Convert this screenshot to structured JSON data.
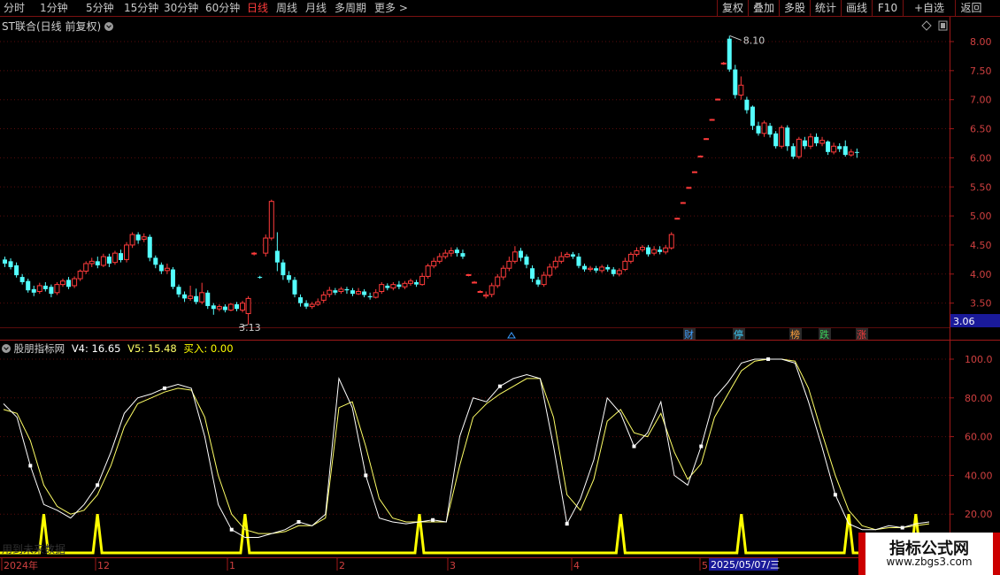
{
  "toolbar": {
    "periods": [
      "分时",
      "1分钟",
      "5分钟",
      "15分钟",
      "30分钟",
      "60分钟",
      "日线",
      "周线",
      "月线",
      "多周期",
      "更多 >"
    ],
    "active_period": "日线",
    "right_buttons": [
      "复权",
      "叠加",
      "多股",
      "统计",
      "画线",
      "F10",
      "+自选",
      "返回"
    ]
  },
  "main_chart": {
    "title": "ST联合(日线 前复权)",
    "price_axis_labels": [
      "8.00",
      "7.50",
      "7.00",
      "6.50",
      "6.00",
      "5.50",
      "5.00",
      "4.50",
      "4.00",
      "3.50"
    ],
    "high_label": "8.10",
    "low_label": "3.13",
    "current_price_tag": "3.06",
    "event_markers": [
      {
        "text": "财",
        "color": "#3c9dff"
      },
      {
        "text": "停",
        "color": "#3ccfff"
      },
      {
        "text": "榜",
        "color": "#ff9f3c"
      },
      {
        "text": "跌",
        "color": "#3ccf5a"
      },
      {
        "text": "涨",
        "color": "#ff3b3b"
      }
    ]
  },
  "indicator": {
    "name": "股朋指标网",
    "v4_label": "V4: 16.65",
    "v5_label": "V5: 15.48",
    "buy_label": "买入: 0.00",
    "axis_labels": [
      "100.0",
      "80.00",
      "60.00",
      "40.00",
      "20.00"
    ],
    "watermark_text": "用到未来数据"
  },
  "time_axis": {
    "labels": [
      "2024年",
      "12",
      "1",
      "2",
      "3",
      "4",
      "5"
    ],
    "cursor_date": "2025/05/07/三"
  },
  "watermark": {
    "title": "指标公式网",
    "url": "www.zbgs3.com"
  },
  "colors": {
    "up": "#ff3b3b",
    "down": "#54ffff",
    "v4_line": "#ffffff",
    "v5_line": "#ffff66",
    "buy_signal": "#ffff00",
    "border": "#7a1010"
  },
  "chart_data": [
    {
      "type": "candlestick",
      "title": "ST联合(日线 前复权)",
      "ylim": [
        3.06,
        8.25
      ],
      "candles": [
        [
          4.25,
          4.18,
          4.3,
          4.12
        ],
        [
          4.22,
          4.12,
          4.27,
          4.08
        ],
        [
          4.15,
          3.98,
          4.2,
          3.94
        ],
        [
          3.95,
          3.86,
          4.0,
          3.82
        ],
        [
          3.88,
          3.72,
          3.92,
          3.68
        ],
        [
          3.74,
          3.68,
          3.8,
          3.62
        ],
        [
          3.7,
          3.8,
          3.85,
          3.66
        ],
        [
          3.8,
          3.74,
          3.86,
          3.7
        ],
        [
          3.78,
          3.66,
          3.82,
          3.6
        ],
        [
          3.68,
          3.82,
          3.86,
          3.64
        ],
        [
          3.82,
          3.88,
          3.92,
          3.78
        ],
        [
          3.9,
          3.78,
          3.95,
          3.74
        ],
        [
          3.8,
          3.92,
          3.96,
          3.76
        ],
        [
          3.92,
          4.05,
          4.08,
          3.88
        ],
        [
          4.05,
          4.18,
          4.22,
          4.0
        ],
        [
          4.18,
          4.22,
          4.28,
          4.12
        ],
        [
          4.22,
          4.15,
          4.3,
          4.1
        ],
        [
          4.15,
          4.3,
          4.35,
          4.12
        ],
        [
          4.3,
          4.18,
          4.35,
          4.12
        ],
        [
          4.2,
          4.36,
          4.4,
          4.16
        ],
        [
          4.36,
          4.24,
          4.42,
          4.2
        ],
        [
          4.25,
          4.5,
          4.55,
          4.2
        ],
        [
          4.5,
          4.68,
          4.72,
          4.45
        ],
        [
          4.68,
          4.58,
          4.72,
          4.52
        ],
        [
          4.6,
          4.64,
          4.7,
          4.55
        ],
        [
          4.64,
          4.28,
          4.68,
          4.22
        ],
        [
          4.28,
          4.16,
          4.32,
          4.1
        ],
        [
          4.16,
          4.05,
          4.2,
          4.0
        ],
        [
          4.06,
          4.1,
          4.18,
          4.0
        ],
        [
          4.08,
          3.78,
          4.12,
          3.74
        ],
        [
          3.78,
          3.65,
          3.82,
          3.6
        ],
        [
          3.65,
          3.58,
          3.7,
          3.52
        ],
        [
          3.58,
          3.62,
          3.8,
          3.54
        ],
        [
          3.62,
          3.52,
          3.75,
          3.48
        ],
        [
          3.52,
          3.68,
          3.85,
          3.48
        ],
        [
          3.68,
          3.45,
          3.72,
          3.4
        ],
        [
          3.46,
          3.4,
          3.5,
          3.3
        ],
        [
          3.4,
          3.44,
          3.48,
          3.36
        ],
        [
          3.44,
          3.38,
          3.48,
          3.34
        ],
        [
          3.38,
          3.48,
          3.5,
          3.36
        ],
        [
          3.48,
          3.4,
          3.52,
          3.36
        ],
        [
          3.38,
          3.5,
          3.54,
          3.34
        ],
        [
          3.32,
          3.58,
          3.62,
          3.13
        ],
        [
          4.35,
          4.36,
          4.38,
          4.32
        ],
        [
          3.95,
          3.94,
          3.97,
          3.92
        ],
        [
          4.36,
          4.62,
          4.68,
          4.3
        ],
        [
          4.62,
          5.25,
          5.28,
          4.58
        ],
        [
          4.4,
          4.2,
          4.72,
          4.05
        ],
        [
          4.2,
          3.98,
          4.25,
          3.9
        ],
        [
          3.98,
          3.9,
          4.05,
          3.85
        ],
        [
          3.9,
          3.65,
          3.95,
          3.6
        ],
        [
          3.6,
          3.5,
          3.65,
          3.44
        ],
        [
          3.5,
          3.44,
          3.55,
          3.4
        ],
        [
          3.44,
          3.48,
          3.52,
          3.4
        ],
        [
          3.48,
          3.52,
          3.58,
          3.45
        ],
        [
          3.55,
          3.64,
          3.7,
          3.5
        ],
        [
          3.65,
          3.72,
          3.78,
          3.6
        ],
        [
          3.72,
          3.68,
          3.76,
          3.64
        ],
        [
          3.7,
          3.74,
          3.78,
          3.66
        ],
        [
          3.74,
          3.72,
          3.78,
          3.66
        ],
        [
          3.72,
          3.66,
          3.76,
          3.62
        ],
        [
          3.66,
          3.7,
          3.76,
          3.64
        ],
        [
          3.7,
          3.64,
          3.74,
          3.6
        ],
        [
          3.62,
          3.6,
          3.68,
          3.56
        ],
        [
          3.6,
          3.68,
          3.74,
          3.58
        ],
        [
          3.7,
          3.82,
          3.86,
          3.66
        ],
        [
          3.8,
          3.76,
          3.84,
          3.72
        ],
        [
          3.76,
          3.82,
          3.86,
          3.72
        ],
        [
          3.82,
          3.78,
          3.88,
          3.74
        ],
        [
          3.78,
          3.84,
          3.88,
          3.74
        ],
        [
          3.84,
          3.88,
          3.92,
          3.8
        ],
        [
          3.86,
          3.82,
          3.9,
          3.78
        ],
        [
          3.82,
          3.96,
          4.02,
          3.8
        ],
        [
          3.96,
          4.14,
          4.18,
          3.92
        ],
        [
          4.14,
          4.22,
          4.28,
          4.1
        ],
        [
          4.22,
          4.3,
          4.36,
          4.18
        ],
        [
          4.3,
          4.36,
          4.42,
          4.26
        ],
        [
          4.36,
          4.4,
          4.46,
          4.3
        ],
        [
          4.42,
          4.36,
          4.46,
          4.3
        ],
        [
          4.36,
          4.3,
          4.42,
          4.26
        ],
        [
          3.98,
          3.99,
          4.0,
          3.96
        ],
        [
          3.85,
          3.86,
          3.88,
          3.84
        ],
        [
          3.7,
          3.7,
          3.72,
          3.68
        ],
        [
          3.62,
          3.64,
          3.7,
          3.58
        ],
        [
          3.65,
          3.8,
          3.85,
          3.6
        ],
        [
          3.8,
          3.95,
          4.0,
          3.76
        ],
        [
          3.95,
          4.1,
          4.15,
          3.9
        ],
        [
          4.1,
          4.22,
          4.3,
          4.05
        ],
        [
          4.22,
          4.38,
          4.48,
          4.18
        ],
        [
          4.4,
          4.28,
          4.45,
          4.22
        ],
        [
          4.3,
          4.16,
          4.34,
          4.1
        ],
        [
          4.1,
          3.92,
          4.15,
          3.86
        ],
        [
          3.9,
          3.82,
          3.95,
          3.78
        ],
        [
          3.82,
          3.98,
          4.04,
          3.78
        ],
        [
          3.98,
          4.12,
          4.18,
          3.94
        ],
        [
          4.12,
          4.22,
          4.3,
          4.08
        ],
        [
          4.22,
          4.3,
          4.38,
          4.18
        ],
        [
          4.3,
          4.34,
          4.38,
          4.28
        ],
        [
          4.34,
          4.3,
          4.38,
          4.26
        ],
        [
          4.3,
          4.14,
          4.36,
          4.1
        ],
        [
          4.14,
          4.08,
          4.18,
          4.04
        ],
        [
          4.08,
          4.1,
          4.14,
          4.04
        ],
        [
          4.1,
          4.06,
          4.14,
          4.02
        ],
        [
          4.06,
          4.12,
          4.16,
          4.02
        ],
        [
          4.12,
          4.08,
          4.16,
          4.04
        ],
        [
          4.08,
          4.0,
          4.12,
          3.96
        ],
        [
          4.0,
          4.06,
          4.1,
          3.96
        ],
        [
          4.08,
          4.22,
          4.28,
          4.05
        ],
        [
          4.22,
          4.34,
          4.38,
          4.18
        ],
        [
          4.34,
          4.4,
          4.46,
          4.3
        ],
        [
          4.42,
          4.46,
          4.5,
          4.38
        ],
        [
          4.46,
          4.34,
          4.5,
          4.3
        ],
        [
          4.36,
          4.42,
          4.48,
          4.32
        ],
        [
          4.42,
          4.38,
          4.48,
          4.34
        ],
        [
          4.38,
          4.45,
          4.5,
          4.34
        ],
        [
          4.45,
          4.68,
          4.72,
          4.42
        ],
        [
          4.95,
          4.96,
          4.97,
          4.94
        ],
        [
          5.22,
          5.23,
          5.24,
          5.21
        ],
        [
          5.48,
          5.49,
          5.5,
          5.47
        ],
        [
          5.75,
          5.76,
          5.77,
          5.74
        ],
        [
          6.02,
          6.03,
          6.04,
          6.01
        ],
        [
          6.32,
          6.33,
          6.34,
          6.31
        ],
        [
          6.65,
          6.66,
          6.67,
          6.64
        ],
        [
          7.0,
          7.01,
          7.02,
          6.99
        ],
        [
          7.62,
          7.63,
          7.65,
          7.6
        ],
        [
          8.05,
          7.52,
          8.1,
          7.48
        ],
        [
          7.52,
          7.08,
          7.6,
          7.02
        ],
        [
          7.08,
          7.25,
          7.4,
          7.0
        ],
        [
          7.0,
          6.82,
          7.05,
          6.76
        ],
        [
          6.88,
          6.55,
          6.9,
          6.48
        ],
        [
          6.55,
          6.42,
          6.62,
          6.38
        ],
        [
          6.42,
          6.6,
          6.64,
          6.36
        ],
        [
          6.55,
          6.4,
          6.6,
          6.35
        ],
        [
          6.42,
          6.2,
          6.46,
          6.16
        ],
        [
          6.2,
          6.52,
          6.56,
          6.16
        ],
        [
          6.52,
          6.2,
          6.56,
          6.12
        ],
        [
          6.2,
          6.02,
          6.25,
          5.98
        ],
        [
          6.02,
          6.32,
          6.36,
          5.98
        ],
        [
          6.3,
          6.2,
          6.36,
          6.15
        ],
        [
          6.2,
          6.36,
          6.42,
          6.15
        ],
        [
          6.36,
          6.25,
          6.42,
          6.2
        ],
        [
          6.25,
          6.3,
          6.36,
          6.2
        ],
        [
          6.28,
          6.1,
          6.3,
          6.05
        ],
        [
          6.1,
          6.2,
          6.26,
          6.06
        ],
        [
          6.2,
          6.15,
          6.25,
          6.1
        ],
        [
          6.2,
          6.05,
          6.3,
          6.02
        ],
        [
          6.05,
          6.1,
          6.15,
          6.02
        ],
        [
          6.1,
          6.09,
          6.16,
          6.0
        ]
      ]
    },
    {
      "type": "line",
      "ylim": [
        0,
        100
      ],
      "series": [
        {
          "name": "V4",
          "values": [
            77,
            70,
            45,
            25,
            22,
            18,
            25,
            35,
            52,
            72,
            80,
            82,
            85,
            87,
            85,
            60,
            25,
            12,
            8,
            8,
            10,
            12,
            16,
            14,
            20,
            90,
            75,
            40,
            18,
            16,
            15,
            16,
            17,
            16,
            60,
            80,
            78,
            86,
            90,
            92,
            90,
            55,
            15,
            28,
            48,
            80,
            72,
            55,
            62,
            78,
            40,
            35,
            55,
            80,
            88,
            98,
            100,
            100,
            100,
            98,
            78,
            55,
            30,
            15,
            12,
            12,
            14,
            13,
            15,
            16
          ]
        },
        {
          "name": "V5",
          "values": [
            74,
            72,
            58,
            35,
            24,
            20,
            22,
            30,
            45,
            65,
            77,
            80,
            83,
            85,
            84,
            70,
            40,
            20,
            12,
            10,
            10,
            11,
            14,
            14,
            18,
            75,
            78,
            55,
            28,
            18,
            16,
            16,
            16,
            16,
            45,
            70,
            77,
            82,
            86,
            90,
            90,
            70,
            30,
            22,
            38,
            68,
            74,
            62,
            60,
            72,
            52,
            38,
            46,
            70,
            82,
            94,
            99,
            100,
            100,
            99,
            85,
            62,
            40,
            22,
            14,
            12,
            13,
            13,
            14,
            15
          ]
        },
        {
          "name": "买入",
          "values": [
            0,
            0,
            0,
            0,
            0,
            0,
            0,
            0,
            0,
            0,
            0,
            0,
            0,
            0,
            0,
            0,
            0,
            0,
            0,
            0,
            0,
            0,
            0,
            0,
            0,
            0,
            0,
            0,
            0,
            0,
            0,
            0,
            0,
            0,
            0,
            0,
            0,
            0,
            0,
            0,
            0,
            0,
            0,
            0,
            0,
            0,
            0,
            0,
            0,
            0,
            0,
            0,
            0,
            0,
            0,
            0,
            0,
            0,
            0,
            0,
            0,
            0,
            0,
            0,
            0,
            0,
            0,
            0,
            0,
            0
          ]
        }
      ],
      "buy_signal_positions": [
        3,
        7,
        18,
        31,
        46,
        55,
        63,
        68
      ],
      "buy_signal_value": 20
    }
  ]
}
